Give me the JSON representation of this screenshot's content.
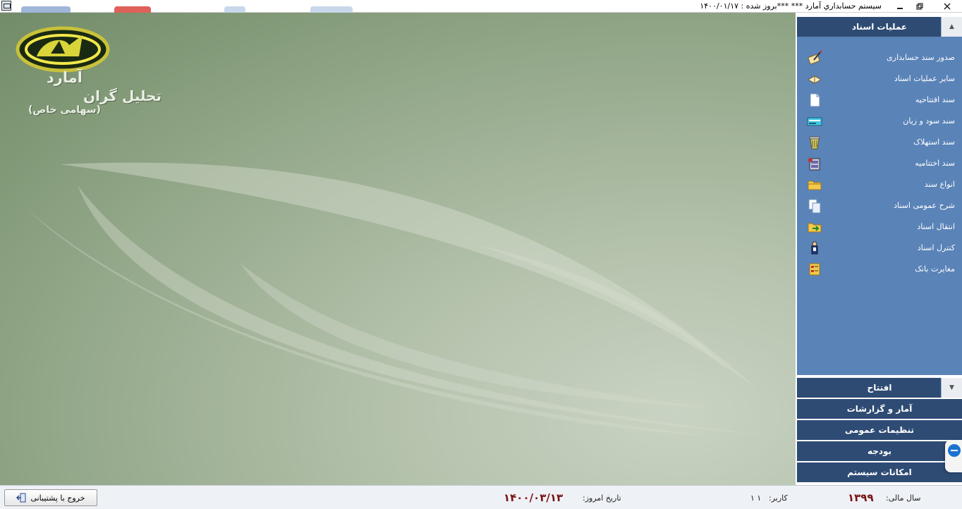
{
  "window": {
    "title": "سيستم حسابداري آمارد   ***   ***بروز شده : ۱۴۰۰/۰۱/۱۷",
    "controls": [
      "minimize-icon",
      "restore-icon",
      "close-icon"
    ]
  },
  "logo": {
    "line1": "آمارد",
    "line2": "تحلیل گران",
    "line3": "(سهامی خاص)"
  },
  "sidebar": {
    "docs_header": "عملیات اسناد",
    "docs_items": [
      {
        "label": "صدور سند حسابداری",
        "icon": "document-pen-icon"
      },
      {
        "label": "سایر عملیات اسناد",
        "icon": "open-book-icon"
      },
      {
        "label": "سند افتتاحیه",
        "icon": "blank-page-icon"
      },
      {
        "label": "سند سود و زیان",
        "icon": "keyboard-icon"
      },
      {
        "label": "سند استهلاک",
        "icon": "trash-bin-icon"
      },
      {
        "label": "سند اختتامیه",
        "icon": "cabinet-icon"
      },
      {
        "label": "انواع سند",
        "icon": "folder-icon"
      },
      {
        "label": "شرح عمومی اسناد",
        "icon": "copy-pages-icon"
      },
      {
        "label": "انتقال اسناد",
        "icon": "folder-arrow-icon"
      },
      {
        "label": "کنترل اسناد",
        "icon": "inspector-icon"
      },
      {
        "label": "مغایرت بانک",
        "icon": "checklist-icon"
      }
    ],
    "opening_header": "افتتاح",
    "sections": [
      {
        "label": "آمار و گزارشات"
      },
      {
        "label": "تنظیمات عمومی"
      },
      {
        "label": "بودجه"
      },
      {
        "label": "امکانات سیستم"
      }
    ]
  },
  "statusbar": {
    "exit_label": "خروج با پشتیبانی",
    "today_label": "تاریخ امروز:",
    "today_value": "۱۴۰۰/۰۳/۱۳",
    "user_label": "کاربر:",
    "user_value": "۱ ۱",
    "fiscal_year_label": "سال مالی:",
    "fiscal_year_value": "۱۳۹۹"
  },
  "colors": {
    "panel_blue": "#5a83b8",
    "header_navy": "#2e4b74",
    "date_red": "#7a1212"
  }
}
